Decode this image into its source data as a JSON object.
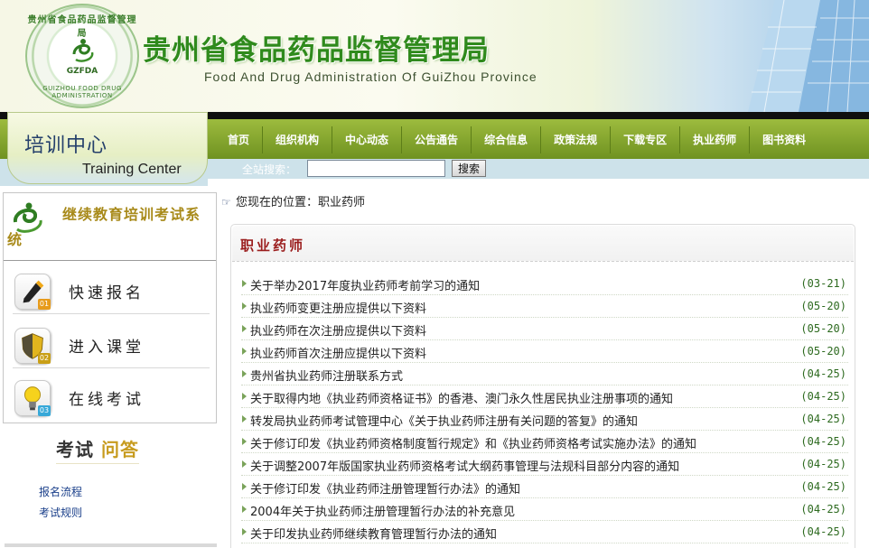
{
  "header": {
    "title": "贵州省食品药品监督管理局",
    "subtitle": "Food And Drug Administration Of GuiZhou Province",
    "logo": {
      "seal_top": "贵州省食品药品监督管理局",
      "seal_bottom": "GUIZHOU FOOD DRUG ADMINISTRATION",
      "abbr": "GZFDA",
      "icon": "agency-seal-icon"
    }
  },
  "training_center": {
    "cn": "培训中心",
    "en": "Training Center"
  },
  "nav": {
    "items": [
      "首页",
      "组织机构",
      "中心动态",
      "公告通告",
      "综合信息",
      "政策法规",
      "下载专区",
      "执业药师",
      "图书资料"
    ]
  },
  "search": {
    "label": "全站搜索：",
    "value": "",
    "button": "搜索"
  },
  "left": {
    "title": "继续教育培训考试系统",
    "items": [
      {
        "label": "快速报名",
        "num": "01",
        "icon": "pen-icon",
        "badge_color": "#e79b1b"
      },
      {
        "label": "进入课堂",
        "num": "02",
        "icon": "shield-icon",
        "badge_color": "#e0b21b"
      },
      {
        "label": "在线考试",
        "num": "03",
        "icon": "lightbulb-icon",
        "badge_color": "#37a8d8"
      }
    ],
    "qa_title_1": "考试",
    "qa_title_2": "问答",
    "links": [
      "报名流程",
      "考试规则"
    ]
  },
  "breadcrumb": "您现在的位置：职业药师",
  "content": {
    "title": "职业药师",
    "news": [
      {
        "title": "关于举办2017年度执业药师考前学习的通知",
        "date": "(03-21)"
      },
      {
        "title": "执业药师变更注册应提供以下资料",
        "date": "(05-20)"
      },
      {
        "title": "执业药师在次注册应提供以下资料",
        "date": "(05-20)"
      },
      {
        "title": "执业药师首次注册应提供以下资料",
        "date": "(05-20)"
      },
      {
        "title": "贵州省执业药师注册联系方式",
        "date": "(04-25)"
      },
      {
        "title": "关于取得内地《执业药师资格证书》的香港、澳门永久性居民执业注册事项的通知",
        "date": "(04-25)"
      },
      {
        "title": "转发局执业药师考试管理中心《关于执业药师注册有关问题的答复》的通知",
        "date": "(04-25)"
      },
      {
        "title": "关于修订印发《执业药师资格制度暂行规定》和《执业药师资格考试实施办法》的通知",
        "date": "(04-25)"
      },
      {
        "title": "关于调整2007年版国家执业药师资格考试大纲药事管理与法规科目部分内容的通知",
        "date": "(04-25)"
      },
      {
        "title": "关于修订印发《执业药师注册管理暂行办法》的通知",
        "date": "(04-25)"
      },
      {
        "title": "2004年关于执业药师注册管理暂行办法的补充意见",
        "date": "(04-25)"
      },
      {
        "title": "关于印发执业药师继续教育管理暂行办法的通知",
        "date": "(04-25)"
      }
    ]
  },
  "colors": {
    "nav_green": "#7a9c28",
    "banner_title_green": "#2f8a1c",
    "content_title_red": "#9b1e1e",
    "date_green": "#2d6a1f",
    "left_title_gold": "#a88a1a"
  }
}
